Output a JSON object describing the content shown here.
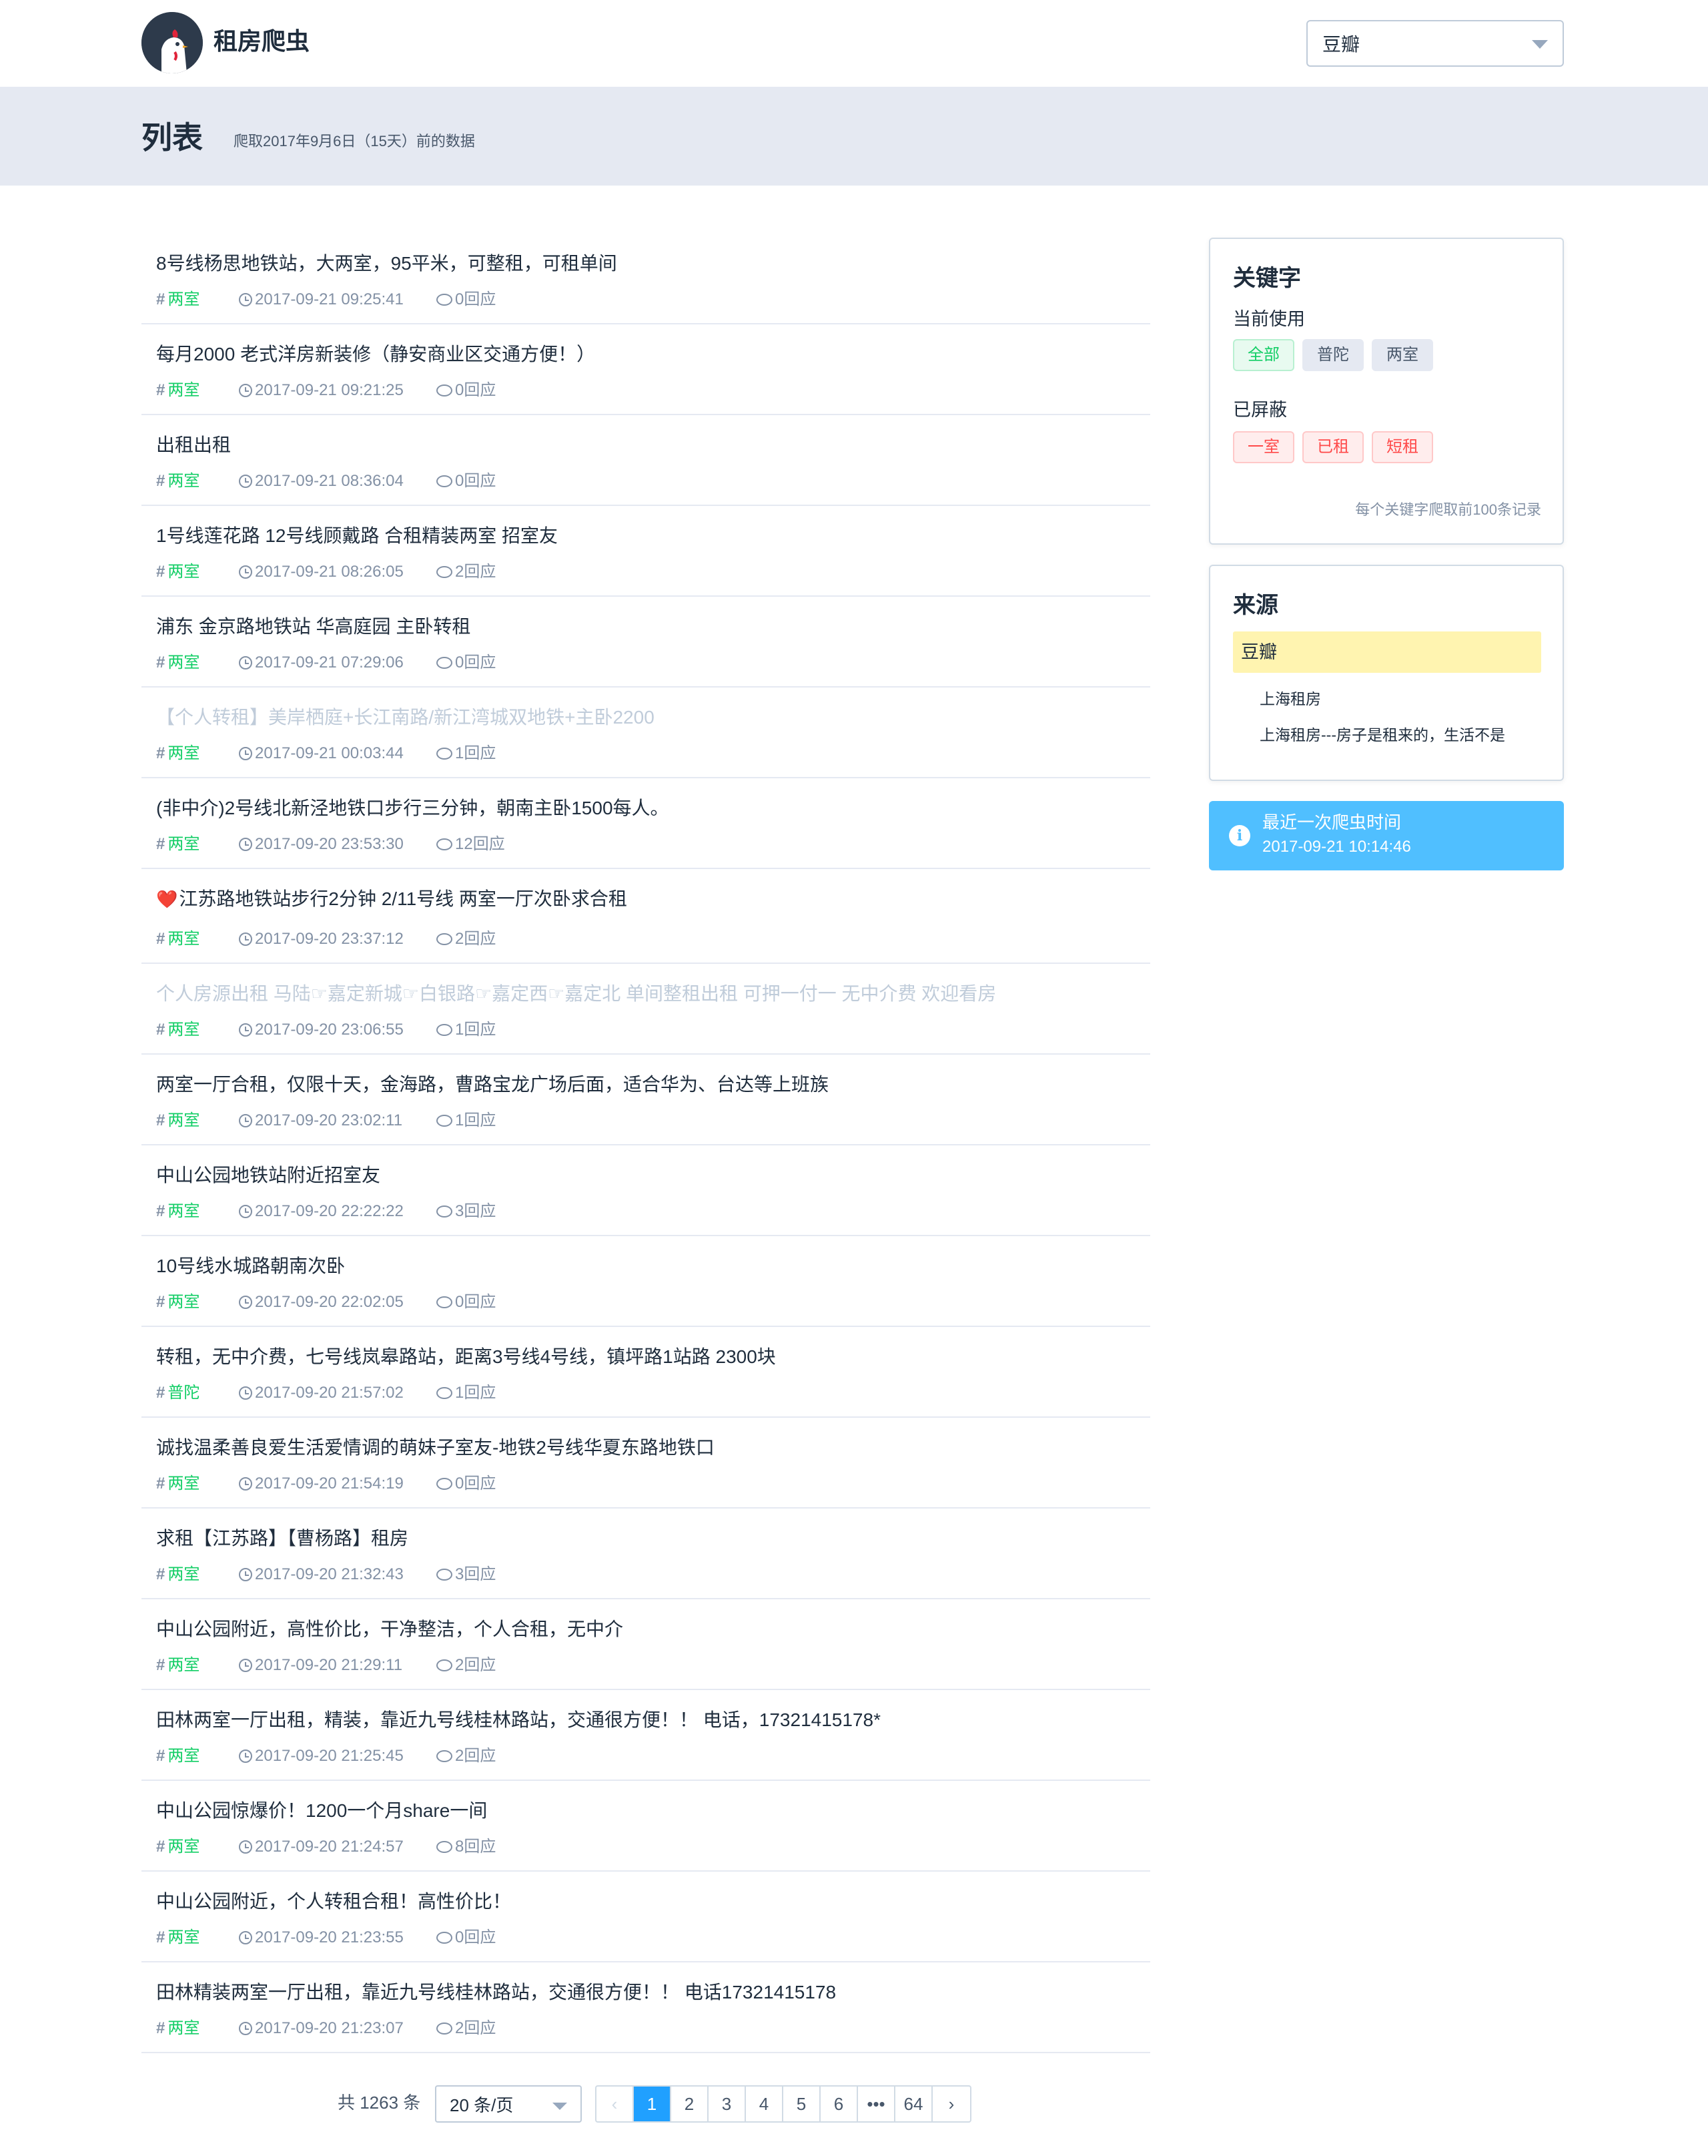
{
  "header": {
    "site_name": "租房爬虫",
    "source_select": "豆瓣"
  },
  "band": {
    "title": "列表",
    "subtitle": "爬取2017年9月6日（15天）前的数据"
  },
  "posts": [
    {
      "title": "8号线杨思地铁站，大两室，95平米，可整租，可租单间",
      "tag": "两室",
      "time": "2017-09-21 09:25:41",
      "replies": "0回应",
      "faded": false
    },
    {
      "title": "每月2000 老式洋房新装修（静安商业区交通方便！）",
      "tag": "两室",
      "time": "2017-09-21 09:21:25",
      "replies": "0回应",
      "faded": false
    },
    {
      "title": "出租出租",
      "tag": "两室",
      "time": "2017-09-21 08:36:04",
      "replies": "0回应",
      "faded": false
    },
    {
      "title": "1号线莲花路 12号线顾戴路 合租精装两室 招室友",
      "tag": "两室",
      "time": "2017-09-21 08:26:05",
      "replies": "2回应",
      "faded": false
    },
    {
      "title": "浦东 金京路地铁站 华高庭园 主卧转租",
      "tag": "两室",
      "time": "2017-09-21 07:29:06",
      "replies": "0回应",
      "faded": false
    },
    {
      "title": "【个人转租】美岸栖庭+长江南路/新江湾城双地铁+主卧2200",
      "tag": "两室",
      "time": "2017-09-21 00:03:44",
      "replies": "1回应",
      "faded": true
    },
    {
      "title": "(非中介)2号线北新泾地铁口步行三分钟，朝南主卧1500每人。",
      "tag": "两室",
      "time": "2017-09-20 23:53:30",
      "replies": "12回应",
      "faded": false
    },
    {
      "title": "江苏路地铁站步行2分钟 2/11号线 两室一厅次卧求合租",
      "tag": "两室",
      "time": "2017-09-20 23:37:12",
      "replies": "2回应",
      "faded": false,
      "heart": "❤️"
    },
    {
      "title": "个人房源出租 马陆☞嘉定新城☞白银路☞嘉定西☞嘉定北 单间整租出租 可押一付一 无中介费 欢迎看房",
      "tag": "两室",
      "time": "2017-09-20 23:06:55",
      "replies": "1回应",
      "faded": true
    },
    {
      "title": "两室一厅合租，仅限十天，金海路，曹路宝龙广场后面，适合华为、台达等上班族",
      "tag": "两室",
      "time": "2017-09-20 23:02:11",
      "replies": "1回应",
      "faded": false
    },
    {
      "title": "中山公园地铁站附近招室友",
      "tag": "两室",
      "time": "2017-09-20 22:22:22",
      "replies": "3回应",
      "faded": false
    },
    {
      "title": "10号线水城路朝南次卧",
      "tag": "两室",
      "time": "2017-09-20 22:02:05",
      "replies": "0回应",
      "faded": false
    },
    {
      "title": "转租，无中介费，七号线岚皋路站，距离3号线4号线，镇坪路1站路 2300块",
      "tag": "普陀",
      "time": "2017-09-20 21:57:02",
      "replies": "1回应",
      "faded": false
    },
    {
      "title": "诚找温柔善良爱生活爱情调的萌妹子室友-地铁2号线华夏东路地铁口",
      "tag": "两室",
      "time": "2017-09-20 21:54:19",
      "replies": "0回应",
      "faded": false
    },
    {
      "title": "求租【江苏路】【曹杨路】租房",
      "tag": "两室",
      "time": "2017-09-20 21:32:43",
      "replies": "3回应",
      "faded": false
    },
    {
      "title": "中山公园附近，高性价比，干净整洁，个人合租，无中介",
      "tag": "两室",
      "time": "2017-09-20 21:29:11",
      "replies": "2回应",
      "faded": false
    },
    {
      "title": "田林两室一厅出租，精装，靠近九号线桂林路站，交通很方便！！ 电话，17321415178*",
      "tag": "两室",
      "time": "2017-09-20 21:25:45",
      "replies": "2回应",
      "faded": false
    },
    {
      "title": "中山公园惊爆价！1200一个月share一间",
      "tag": "两室",
      "time": "2017-09-20 21:24:57",
      "replies": "8回应",
      "faded": false
    },
    {
      "title": "中山公园附近，个人转租合租！高性价比！",
      "tag": "两室",
      "time": "2017-09-20 21:23:55",
      "replies": "0回应",
      "faded": false
    },
    {
      "title": "田林精装两室一厅出租，靠近九号线桂林路站，交通很方便！！ 电话17321415178",
      "tag": "两室",
      "time": "2017-09-20 21:23:07",
      "replies": "2回应",
      "faded": false
    }
  ],
  "pagination": {
    "total": "共 1263 条",
    "page_size": "20 条/页",
    "pages": [
      "1",
      "2",
      "3",
      "4",
      "5",
      "6",
      "•••",
      "64"
    ],
    "prev": "‹",
    "next": "›"
  },
  "keywords": {
    "title": "关键字",
    "current_label": "当前使用",
    "current": [
      "全部",
      "普陀",
      "两室"
    ],
    "blocked_label": "已屏蔽",
    "blocked": [
      "一室",
      "已租",
      "短租"
    ],
    "note": "每个关键字爬取前100条记录"
  },
  "source": {
    "title": "来源",
    "selected": "豆瓣",
    "items": [
      "上海租房",
      "上海租房---房子是租来的，生活不是"
    ]
  },
  "info": {
    "line1": "最近一次爬虫时间",
    "line2": "2017-09-21 10:14:46"
  },
  "colors": {
    "accent": "#20a0ff",
    "tag_green": "#13ce66",
    "info_blue": "#50bfff",
    "highlight": "#fff4b0"
  }
}
